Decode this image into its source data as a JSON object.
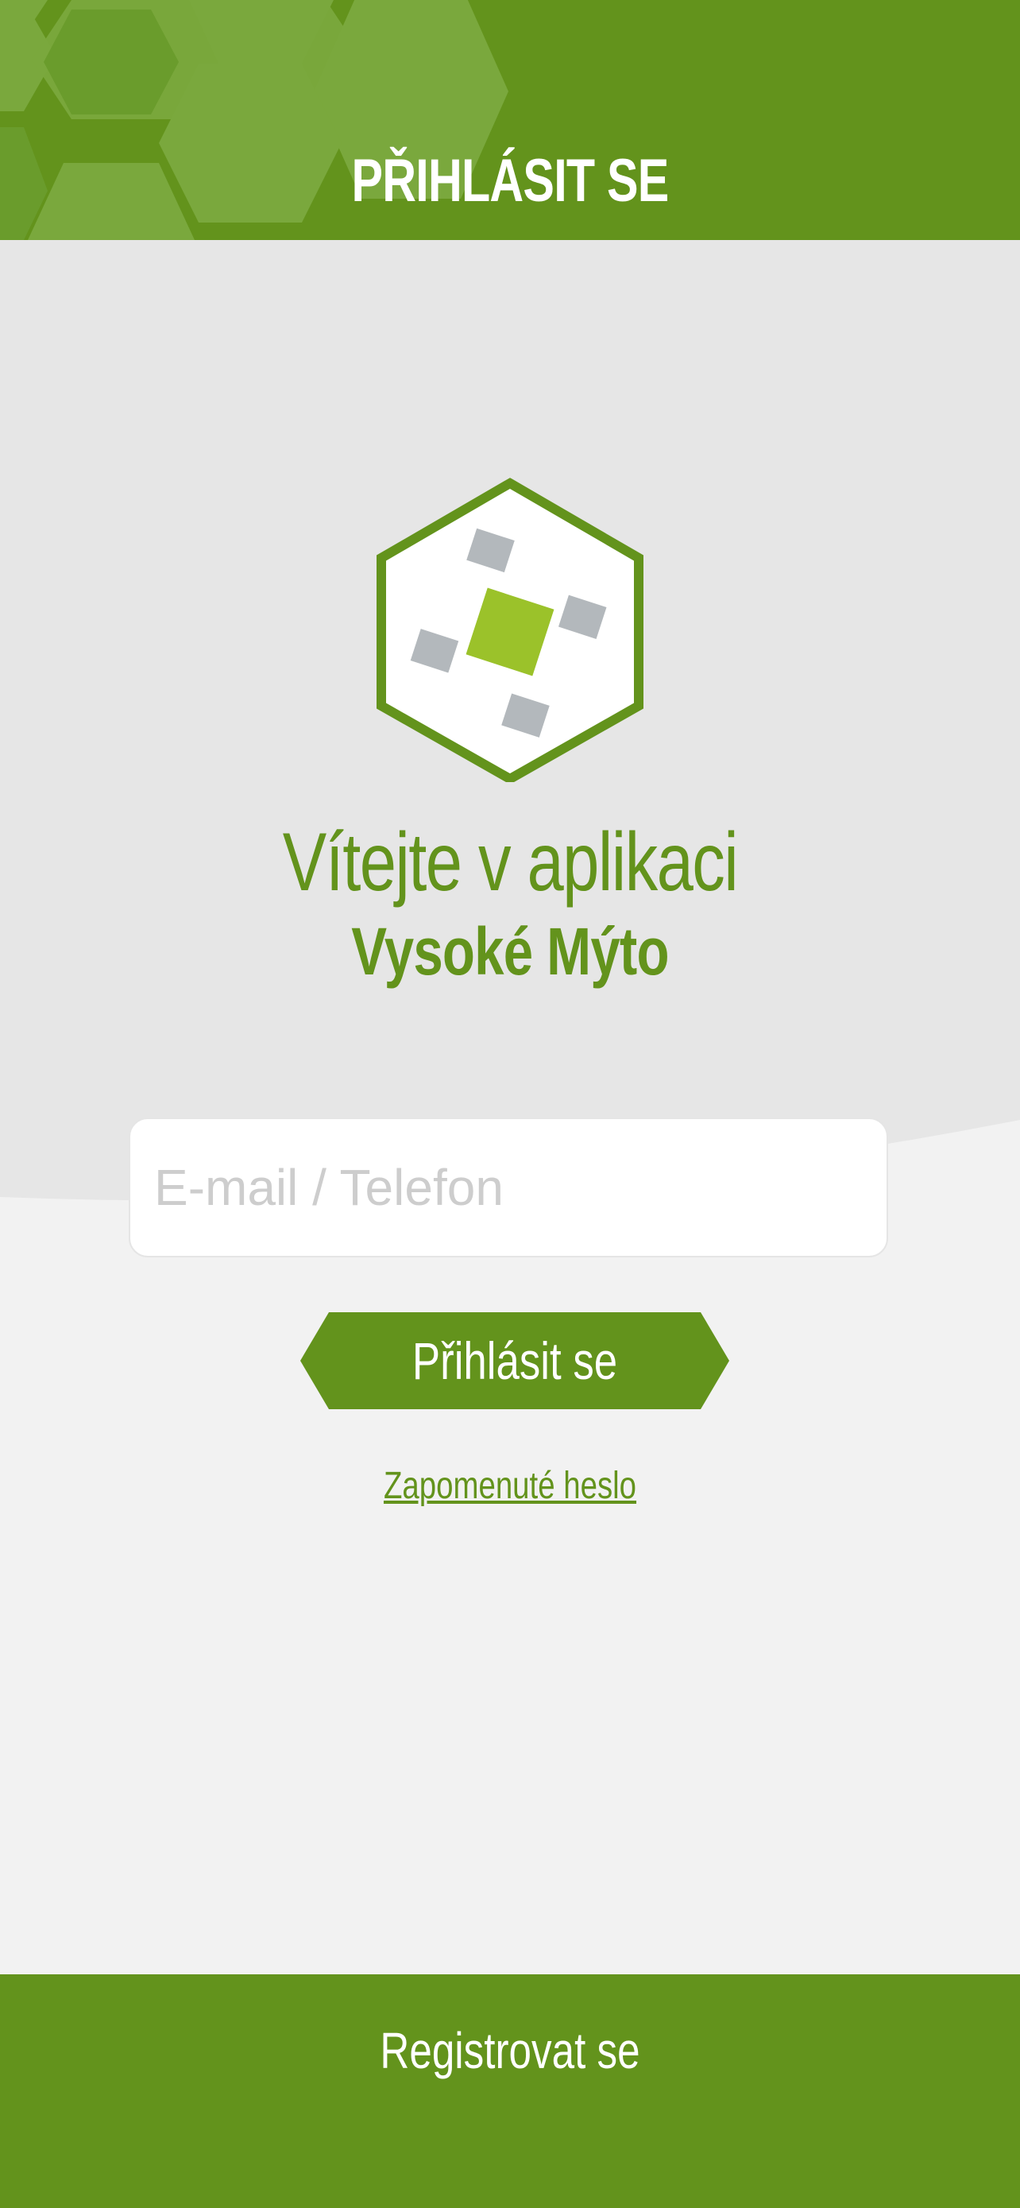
{
  "header": {
    "title": "PŘIHLÁSIT SE"
  },
  "welcome": {
    "line1": "Vítejte v aplikaci",
    "app_name": "Vysoké Mýto"
  },
  "login_form": {
    "identifier_placeholder": "E-mail / Telefon",
    "identifier_value": "",
    "submit_label": "Přihlásit se",
    "forgot_password_label": "Zapomenuté heslo"
  },
  "footer": {
    "register_label": "Registrovat se"
  },
  "colors": {
    "brand_green": "#63931c",
    "logo_accent_green": "#9bc22a",
    "logo_grey": "#b3b8bc",
    "background_light": "#f2f2f2",
    "background_dark": "#e6e6e6"
  },
  "icons": {
    "logo": "hexagon-drone-logo-icon"
  }
}
